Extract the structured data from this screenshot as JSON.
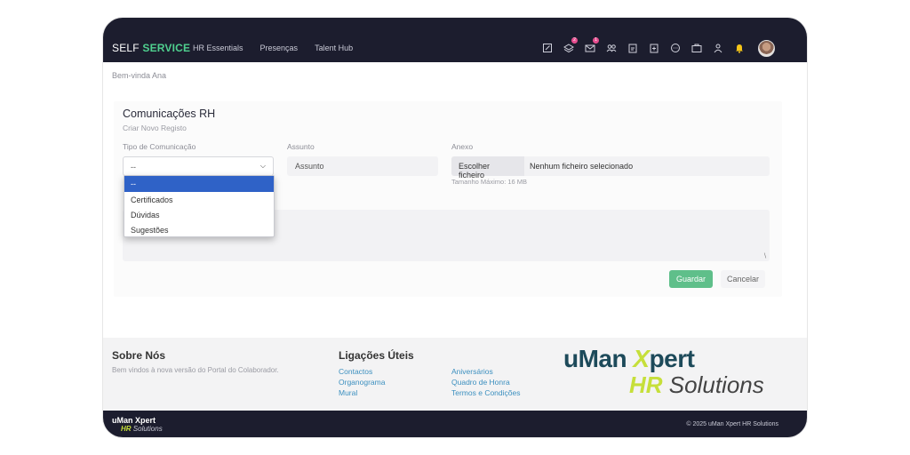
{
  "header": {
    "brand_part1": "SELF",
    "brand_part2": "SERVICE",
    "nav": [
      "HR Essentials",
      "Presenças",
      "Talent Hub"
    ],
    "icons": [
      {
        "name": "edit-icon",
        "badge": ""
      },
      {
        "name": "layers-icon",
        "badge": "2"
      },
      {
        "name": "mail-icon",
        "badge": "1"
      },
      {
        "name": "users-icon",
        "badge": ""
      },
      {
        "name": "clipboard-icon",
        "badge": ""
      },
      {
        "name": "plus-clipboard-icon",
        "badge": ""
      },
      {
        "name": "chat-icon",
        "badge": ""
      },
      {
        "name": "briefcase-icon",
        "badge": ""
      },
      {
        "name": "user-icon",
        "badge": ""
      },
      {
        "name": "bell-icon",
        "badge": ""
      }
    ]
  },
  "greeting": "Bem-vinda Ana",
  "form": {
    "title": "Comunicações RH",
    "subtitle": "Criar Novo Registo",
    "type_label": "Tipo de Comunicação",
    "type_value": "--",
    "subject_label": "Assunto",
    "subject_placeholder": "Assunto",
    "attach_label": "Anexo",
    "attach_button": "Escolher ficheiro",
    "attach_status": "Nenhum ficheiro selecionado",
    "attach_hint": "Tamanho Máximo: 16 MB",
    "save": "Guardar",
    "cancel": "Cancelar",
    "options": [
      "--",
      "Certificados",
      "Dúvidas",
      "Sugestões"
    ]
  },
  "footer": {
    "about_title": "Sobre Nós",
    "about_text": "Bem vindos à nova versão do Portal do Colaborador.",
    "links_title": "Ligações Úteis",
    "links_col1": [
      "Contactos",
      "Organograma",
      "Mural"
    ],
    "links_col2": [
      "Aniversários",
      "Quadro de Honra",
      "Termos e Condições"
    ],
    "logo_line1_a": "uMan ",
    "logo_line1_b": "X",
    "logo_line1_c": "pert",
    "logo_line2_a": "HR",
    "logo_line2_b": " Solutions",
    "mini_logo_1": "uMan Xpert",
    "mini_logo_2a": "HR",
    "mini_logo_2b": " Solutions",
    "copyright": "© 2025 uMan Xpert HR Solutions"
  },
  "colors": {
    "header_bg": "#1c1d2e",
    "accent_green": "#4fd08f",
    "save_btn": "#5fbf8a",
    "link": "#3b8fbf",
    "dropdown_selected": "#2f62c7"
  }
}
